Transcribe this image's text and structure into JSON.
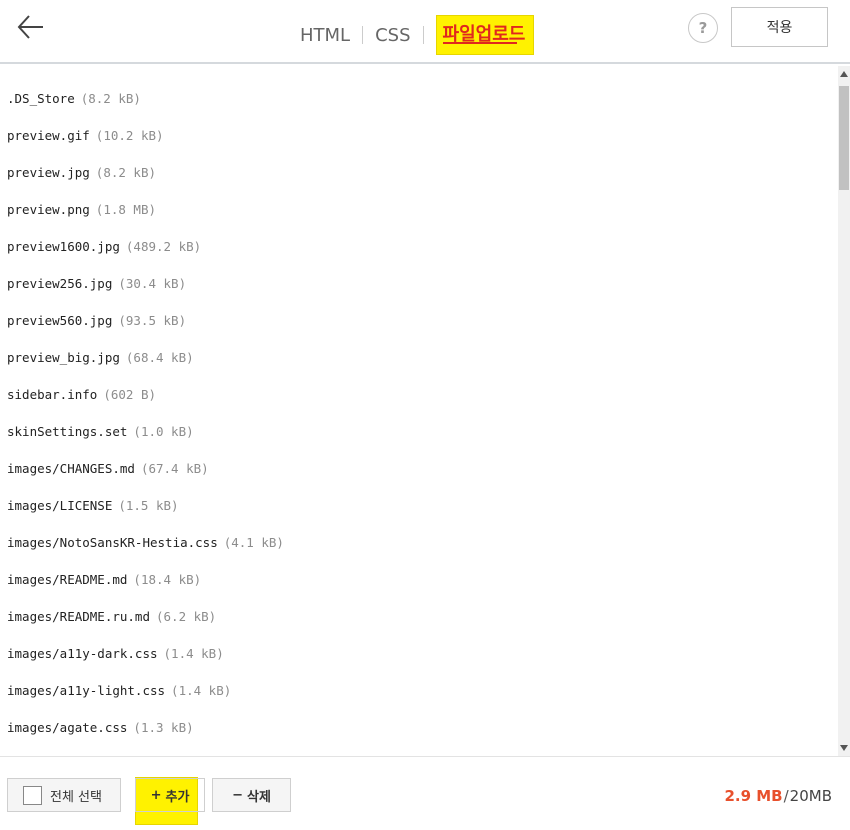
{
  "header": {
    "tabs": [
      {
        "label": "HTML",
        "active": false
      },
      {
        "label": "CSS",
        "active": false
      },
      {
        "label": "파일업로드",
        "active": true
      }
    ],
    "help_label": "?",
    "apply_label": "적용",
    "icons": {
      "back": "arrow-left-icon",
      "help": "question-icon"
    }
  },
  "files": [
    {
      "name": ".DS_Store",
      "size": "(8.2 kB)"
    },
    {
      "name": "preview.gif",
      "size": "(10.2 kB)"
    },
    {
      "name": "preview.jpg",
      "size": "(8.2 kB)"
    },
    {
      "name": "preview.png",
      "size": "(1.8 MB)"
    },
    {
      "name": "preview1600.jpg",
      "size": "(489.2 kB)"
    },
    {
      "name": "preview256.jpg",
      "size": "(30.4 kB)"
    },
    {
      "name": "preview560.jpg",
      "size": "(93.5 kB)"
    },
    {
      "name": "preview_big.jpg",
      "size": "(68.4 kB)"
    },
    {
      "name": "sidebar.info",
      "size": "(602 B)"
    },
    {
      "name": "skinSettings.set",
      "size": "(1.0 kB)"
    },
    {
      "name": "images/CHANGES.md",
      "size": "(67.4 kB)"
    },
    {
      "name": "images/LICENSE",
      "size": "(1.5 kB)"
    },
    {
      "name": "images/NotoSansKR-Hestia.css",
      "size": "(4.1 kB)"
    },
    {
      "name": "images/README.md",
      "size": "(18.4 kB)"
    },
    {
      "name": "images/README.ru.md",
      "size": "(6.2 kB)"
    },
    {
      "name": "images/a11y-dark.css",
      "size": "(1.4 kB)"
    },
    {
      "name": "images/a11y-light.css",
      "size": "(1.4 kB)"
    },
    {
      "name": "images/agate.css",
      "size": "(1.3 kB)"
    }
  ],
  "footer": {
    "select_all_label": "전체 선택",
    "add_icon": "+",
    "add_label": "추가",
    "delete_icon": "−",
    "delete_label": "삭제",
    "usage_used": "2.9 MB",
    "usage_sep": "/",
    "usage_total": "20MB"
  },
  "colors": {
    "accent": "#e0281e",
    "usage_used": "#e8502c",
    "highlight": "#fff200"
  }
}
